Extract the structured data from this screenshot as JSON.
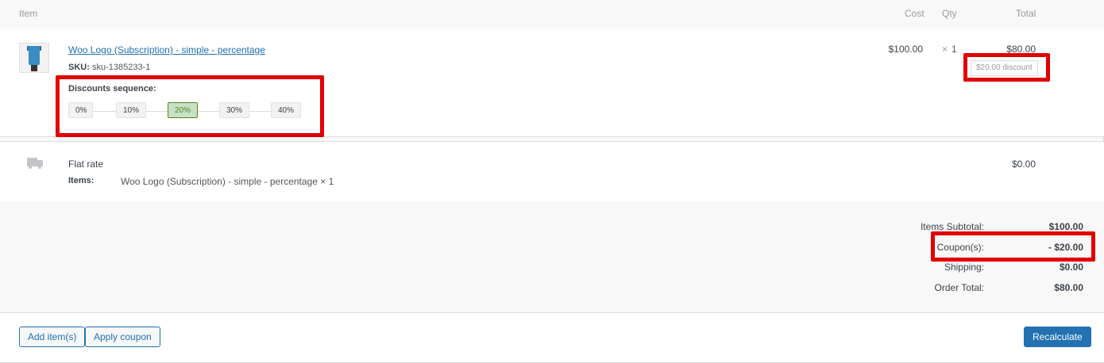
{
  "header": {
    "item": "Item",
    "cost": "Cost",
    "qty": "Qty",
    "total": "Total"
  },
  "line_item": {
    "name": "Woo Logo (Subscription) - simple - percentage",
    "sku_label": "SKU:",
    "sku": "sku-1385233-1",
    "cost": "$100.00",
    "qty_prefix": "×",
    "qty": "1",
    "total": "$80.00",
    "discount_badge": "$20.00 discount",
    "discounts_sequence_label": "Discounts sequence:",
    "discount_steps": [
      "0%",
      "10%",
      "20%",
      "30%",
      "40%"
    ],
    "active_step": "20%"
  },
  "shipping": {
    "method": "Flat rate",
    "items_label": "Items:",
    "items_value": "Woo Logo (Subscription) - simple - percentage × 1",
    "total": "$0.00"
  },
  "totals": {
    "subtotal_label": "Items Subtotal:",
    "subtotal": "$100.00",
    "coupons_label": "Coupon(s):",
    "coupons": "- $20.00",
    "shipping_label": "Shipping:",
    "shipping": "$0.00",
    "order_total_label": "Order Total:",
    "order_total": "$80.00"
  },
  "actions": {
    "add_items": "Add item(s)",
    "apply_coupon": "Apply coupon",
    "recalculate": "Recalculate"
  },
  "colors": {
    "highlight": "#e10000",
    "link": "#2271b1",
    "active_step_bg": "#c6e1c6",
    "active_step_text": "#5b841b"
  }
}
